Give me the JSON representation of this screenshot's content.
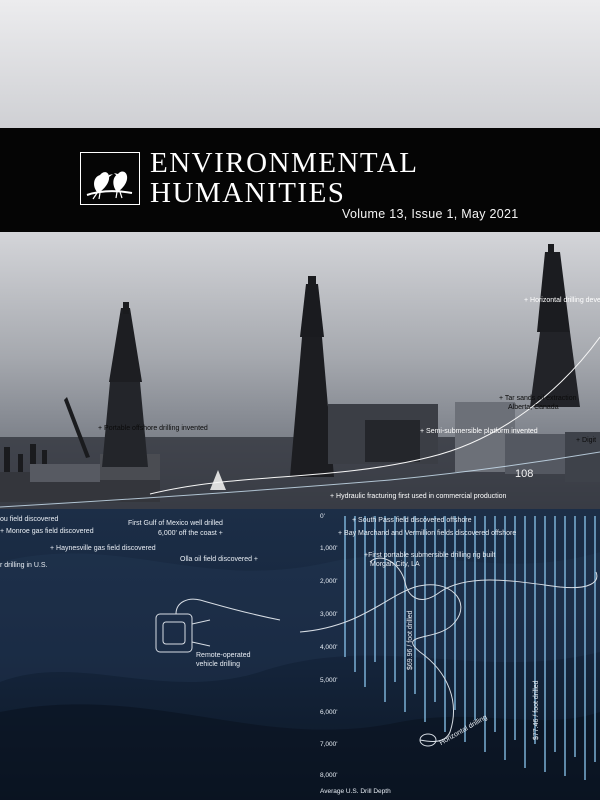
{
  "journal": {
    "title_line1": "ENVIRONMENTAL",
    "title_line2": "HUMANITIES",
    "issue": "Volume 13, Issue 1, May 2021",
    "logo_icon": "two-birds-on-branch-icon"
  },
  "colors": {
    "title_band": "#050505",
    "sky_top": "#ececee",
    "ocean": "#0d1a2c",
    "depth_lines": "#7fb6dc"
  },
  "timeline_labels": {
    "portable_offshore": "+ Portable offshore drilling invented",
    "semi_submersible": "+ Semi-submersible platform invented",
    "tar_sands": "+ Tar sands oil extraction",
    "tar_sands_place": "Alberta, Canada",
    "horizontal_drilling": "+ Horizontal drilling deve",
    "digital": "+ Digit",
    "hydraulic": "+ Hydraulic fracturing first used in commercial production",
    "rig_number": "108",
    "bayou_field": "ou field discovered",
    "monroe_gas": "+ Monroe gas field discovered",
    "haynesville_gas": "+ Haynesville gas field discovered",
    "drilling_us": "r drilling in U.S.",
    "gulf_well": "First Gulf of Mexico well drilled",
    "gulf_well_detail": "6,000' off the coast +",
    "olla_oil": "Olla oil field discovered +",
    "south_pass": "+ South Pass field discovered offshore",
    "bay_marchand": "+ Bay Marchand and Vermillion fields discovered offshore",
    "portable_sub": "+First portable submersible drilling rig built",
    "portable_sub_place": "Morgan City, LA",
    "remote_vehicle": "Remote-operated",
    "remote_vehicle_2": "vehicle drilling",
    "cost_1": "$69.96 / foot drilled",
    "cost_2": "$77.46 / foot drilled",
    "horizontal_label": "Horizontal drilling"
  },
  "depth_axis": {
    "ticks": [
      "0'",
      "1,000'",
      "2,000'",
      "3,000'",
      "4,000'",
      "5,000'",
      "6,000'",
      "7,000'",
      "8,000'"
    ],
    "title": "Average U.S. Drill Depth"
  }
}
